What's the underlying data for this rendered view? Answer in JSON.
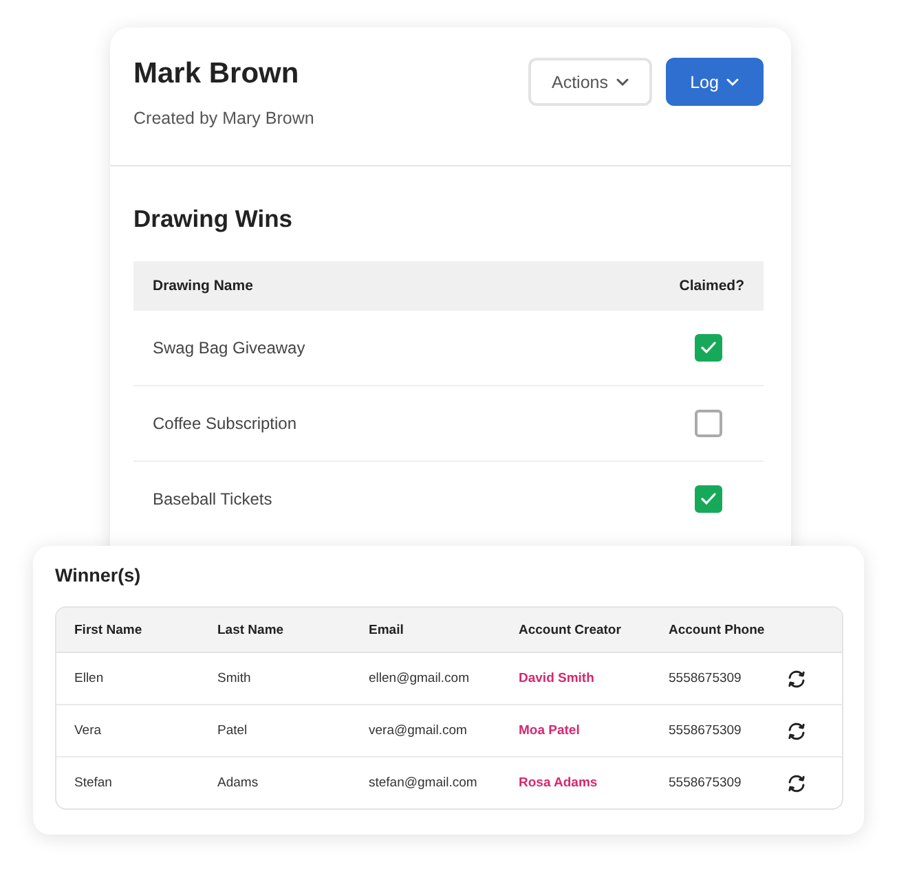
{
  "header": {
    "title": "Mark Brown",
    "subtitle": "Created by Mary Brown",
    "buttons": [
      {
        "label": "Actions",
        "kind": "outline"
      },
      {
        "label": "Log",
        "kind": "primary"
      }
    ]
  },
  "drawing_wins": {
    "title": "Drawing Wins",
    "columns": [
      "Drawing Name",
      "Claimed?"
    ],
    "rows": [
      {
        "name": "Swag Bag Giveaway",
        "claimed": true
      },
      {
        "name": "Coffee Subscription",
        "claimed": false
      },
      {
        "name": "Baseball Tickets",
        "claimed": true
      }
    ]
  },
  "winners": {
    "title": "Winner(s)",
    "columns": [
      "First Name",
      "Last Name",
      "Email",
      "Account Creator",
      "Account Phone"
    ],
    "rows": [
      {
        "first_name": "Ellen",
        "last_name": "Smith",
        "email": "ellen@gmail.com",
        "account_creator": "David Smith",
        "account_phone": "5558675309"
      },
      {
        "first_name": "Vera",
        "last_name": "Patel",
        "email": "vera@gmail.com",
        "account_creator": "Moa Patel",
        "account_phone": "5558675309"
      },
      {
        "first_name": "Stefan",
        "last_name": "Adams",
        "email": "stefan@gmail.com",
        "account_creator": "Rosa Adams",
        "account_phone": "5558675309"
      }
    ]
  }
}
